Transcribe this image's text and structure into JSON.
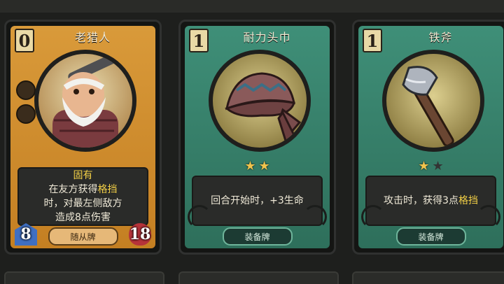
{
  "cards": [
    {
      "name": "老猎人",
      "cost": "0",
      "desc": {
        "keyword_title": "固有",
        "line1_pre": "在友方获得",
        "line1_kw": "格挡",
        "line2": "时，对最左侧敌方",
        "line3": "造成8点伤害"
      },
      "tag": "随从牌",
      "attack": "8",
      "health": "18",
      "frame_color": "#d99a3a",
      "art_icon": "old-hunter-portrait-icon"
    },
    {
      "name": "耐力头巾",
      "cost": "1",
      "stars_on": 2,
      "stars_total": 2,
      "desc": {
        "line1": "回合开始时，+3生命"
      },
      "tag": "装备牌",
      "frame_color": "#3f8f78",
      "art_icon": "bandana-icon"
    },
    {
      "name": "铁斧",
      "cost": "1",
      "stars_on": 1,
      "stars_total": 2,
      "desc": {
        "line1_pre": "攻击时，获得3点",
        "line1_kw": "格挡"
      },
      "tag": "装备牌",
      "frame_color": "#3f8f78",
      "art_icon": "axe-icon"
    }
  ]
}
